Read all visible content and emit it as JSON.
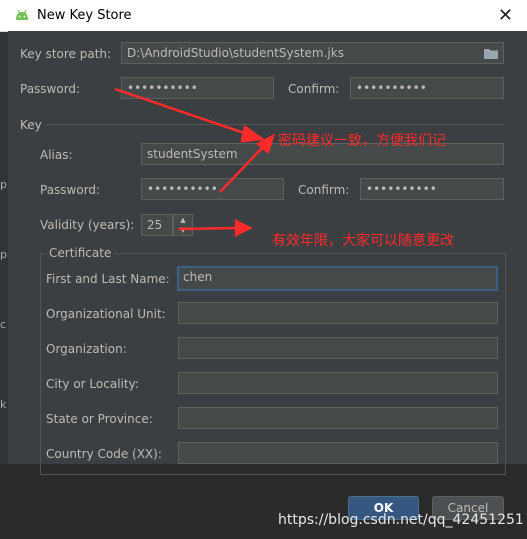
{
  "window": {
    "title": "New Key Store"
  },
  "keystore": {
    "path_label": "Key store path:",
    "path_value": "D:\\AndroidStudio\\studentSystem.jks",
    "password_label": "Password:",
    "password_value": "••••••••••",
    "confirm_label": "Confirm:",
    "confirm_value": "••••••••••"
  },
  "key": {
    "section_label": "Key",
    "alias_label": "Alias:",
    "alias_value": "studentSystem",
    "password_label": "Password:",
    "password_value": "••••••••••",
    "confirm_label": "Confirm:",
    "confirm_value": "••••••••••",
    "validity_label": "Validity (years):",
    "validity_value": "25"
  },
  "certificate": {
    "section_label": "Certificate",
    "first_last_label": "First and Last Name:",
    "first_last_value": "chen",
    "org_unit_label": "Organizational Unit:",
    "org_unit_value": "",
    "org_label": "Organization:",
    "org_value": "",
    "city_label": "City or Locality:",
    "city_value": "",
    "state_label": "State or Province:",
    "state_value": "",
    "country_label": "Country Code (XX):",
    "country_value": ""
  },
  "buttons": {
    "ok": "OK",
    "cancel": "Cancel"
  },
  "annotations": {
    "password_note": "密码建议一致，方便我们记",
    "validity_note": "有效年限，大家可以随意更改"
  },
  "watermark": "https://blog.csdn.net/qq_42451251",
  "colors": {
    "annotation": "#ff2a2a",
    "ok_button": "#365880",
    "focus_border": "#3d6185"
  },
  "icons": {
    "app": "android-icon",
    "close": "close-icon",
    "folder": "folder-icon",
    "spinner_up": "chevron-up-icon",
    "spinner_down": "chevron-down-icon"
  }
}
